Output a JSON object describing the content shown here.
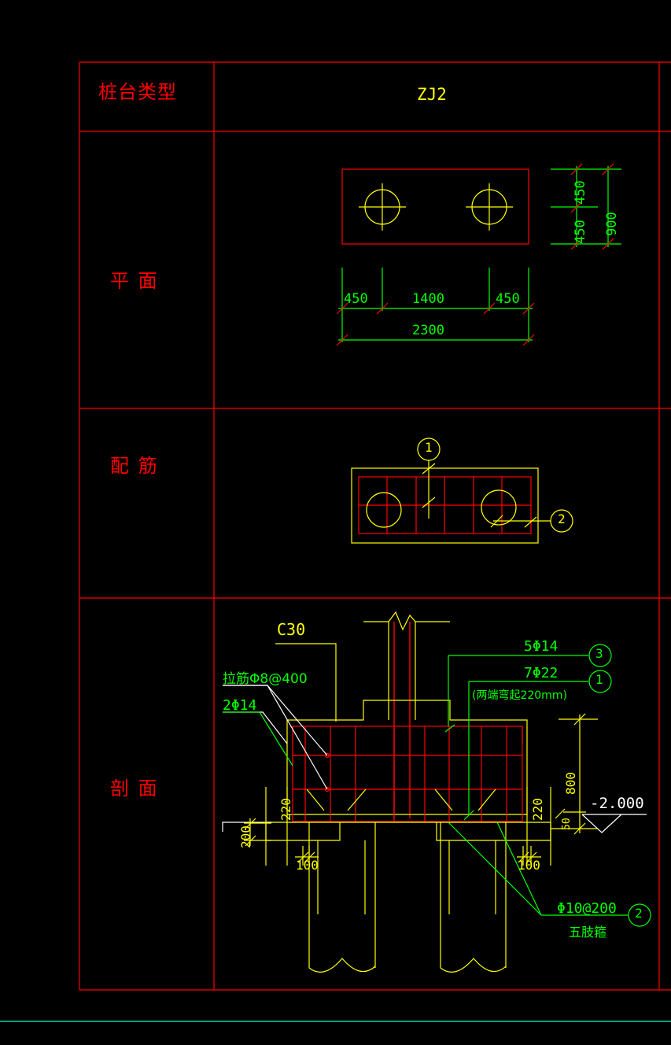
{
  "drawing": {
    "title_row": {
      "label": "桩台类型",
      "value": "ZJ2"
    },
    "rows": [
      {
        "key": "plan",
        "label": "平 面"
      },
      {
        "key": "rebar",
        "label": "配 筋"
      },
      {
        "key": "section",
        "label": "剖 面"
      }
    ],
    "plan_view": {
      "dims_horizontal": [
        "450",
        "1400",
        "450"
      ],
      "dim_total_horizontal": "2300",
      "dims_vertical": [
        "450",
        "450"
      ],
      "dim_total_vertical": "900"
    },
    "rebar_view": {
      "callouts": [
        "1",
        "2"
      ]
    },
    "section_view": {
      "concrete_grade": "C30",
      "tie_bar": "拉筋Φ8@400",
      "side_bar": "2Φ14",
      "top_bar": "5Φ14",
      "top_bar_callout": "3",
      "bottom_bar": "7Φ22",
      "bottom_bar_callout": "1",
      "bottom_bar_note": "(两端弯起220mm)",
      "stirrup": "Φ10@200",
      "stirrup_note": "五肢箍",
      "stirrup_callout": "2",
      "level_mark": "-2.000",
      "dim_cap_depth": "800",
      "dim_cover_bottom": "50",
      "dim_embed_left": "220",
      "dim_embed_right": "220",
      "dim_pile_top_left": "200",
      "dim_pile_edge_left": "100",
      "dim_pile_edge_right": "100"
    },
    "colors": {
      "frame": "#ff0000",
      "concrete": "#ffff00",
      "rebar": "#ff0000",
      "dimension": "#00ff00",
      "annotation_white": "#ffffff",
      "footer_line": "#00ffcc",
      "background": "#000000"
    }
  }
}
